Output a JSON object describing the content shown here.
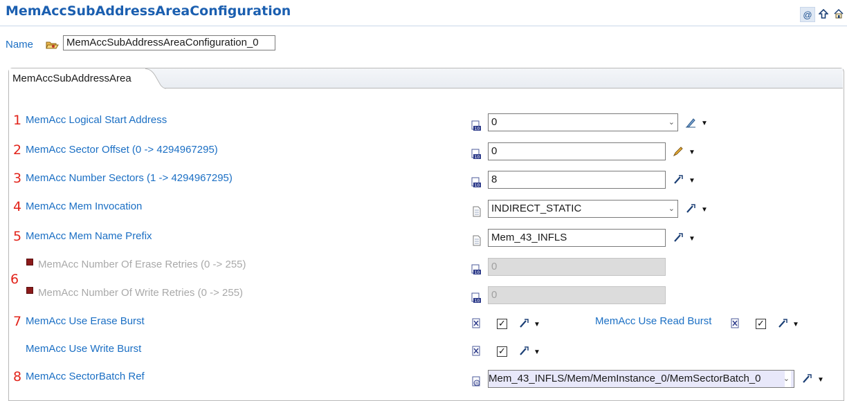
{
  "header": {
    "title": "MemAccSubAddressAreaConfiguration",
    "toolbar_icons": [
      "at-icon",
      "up-arrow-icon",
      "home-icon"
    ]
  },
  "name_row": {
    "label": "Name",
    "value": "MemAccSubAddressAreaConfiguration_0"
  },
  "tab": {
    "label": "MemAccSubAddressArea"
  },
  "rows": [
    {
      "num": "1",
      "label": "MemAcc Logical Start Address",
      "value": "0"
    },
    {
      "num": "2",
      "label": "MemAcc Sector Offset (0 -> 4294967295)",
      "value": "0"
    },
    {
      "num": "3",
      "label": "MemAcc Number Sectors (1 -> 4294967295)",
      "value": "8"
    },
    {
      "num": "4",
      "label": "MemAcc Mem Invocation",
      "value": "INDIRECT_STATIC"
    },
    {
      "num": "5",
      "label": "MemAcc Mem Name Prefix",
      "value": "Mem_43_INFLS"
    },
    {
      "num": "6",
      "label": "MemAcc Number Of Erase Retries (0 -> 255)",
      "value": "0"
    },
    {
      "num": "",
      "label": "MemAcc Number Of Write Retries (0 -> 255)",
      "value": "0"
    },
    {
      "num": "7",
      "label": "MemAcc Use Erase Burst",
      "checked": "✓"
    },
    {
      "num": "",
      "label": "MemAcc Use Read Burst",
      "checked": "✓"
    },
    {
      "num": "",
      "label": "MemAcc Use Write Burst",
      "checked": "✓"
    },
    {
      "num": "8",
      "label": "MemAcc SectorBatch Ref",
      "value": "Mem_43_INFLS/Mem/MemInstance_0/MemSectorBatch_0"
    }
  ],
  "colors": {
    "title": "#1b5fb0",
    "label": "#1b6fc4",
    "row_number": "#e2231a",
    "disabled": "#a9a9a9"
  }
}
